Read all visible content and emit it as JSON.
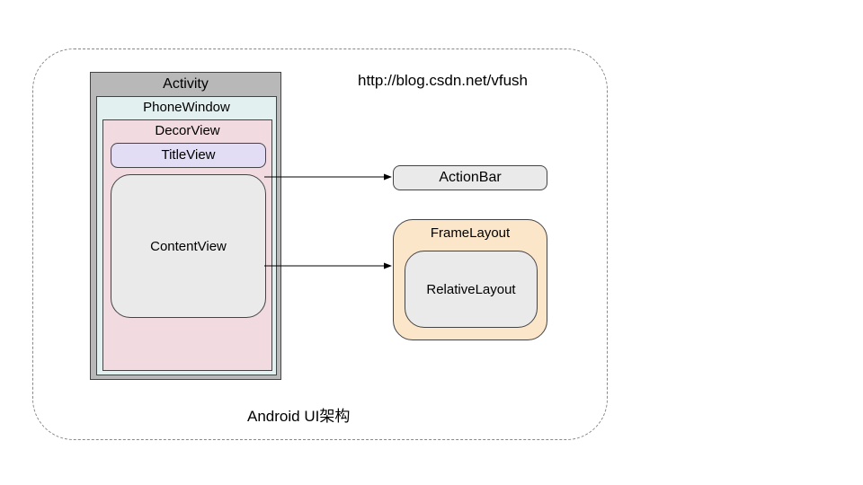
{
  "sourceUrl": "http://blog.csdn.net/vfush",
  "caption": "Android UI架构",
  "boxes": {
    "activity": "Activity",
    "phoneWindow": "PhoneWindow",
    "decorView": "DecorView",
    "titleView": "TitleView",
    "contentView": "ContentView",
    "actionBar": "ActionBar",
    "frameLayout": "FrameLayout",
    "relativeLayout": "RelativeLayout"
  }
}
